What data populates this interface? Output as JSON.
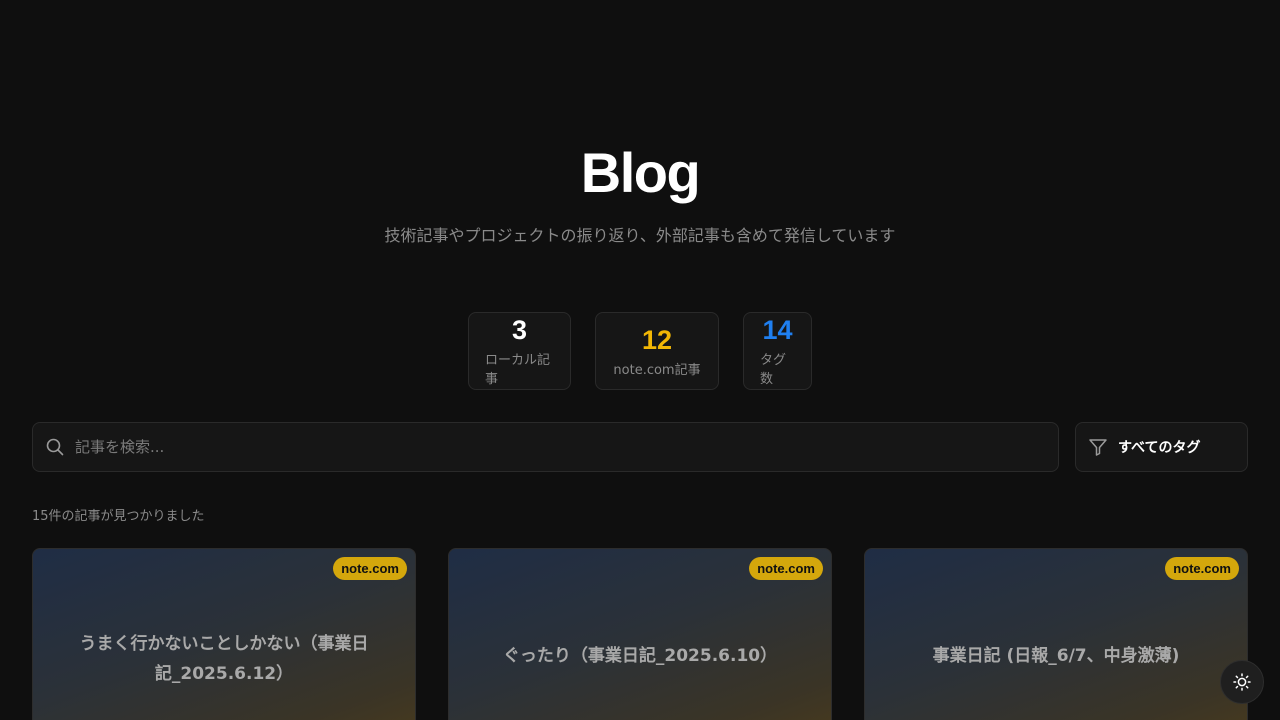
{
  "hero": {
    "title": "Blog",
    "subtitle": "技術記事やプロジェクトの振り返り、外部記事も含めて発信しています"
  },
  "stats": [
    {
      "value": "3",
      "label": "ローカル記事",
      "color": "#ffffff"
    },
    {
      "value": "12",
      "label": "note.com記事",
      "color": "#f2b705"
    },
    {
      "value": "14",
      "label": "タグ数",
      "color": "#1f7ff0"
    }
  ],
  "search": {
    "icon": "search-icon",
    "placeholder": "記事を検索..."
  },
  "filter": {
    "icon": "filter-icon",
    "label": "すべてのタグ"
  },
  "results": {
    "count_text": "15件の記事が見つかりました"
  },
  "articles": [
    {
      "badge": "note.com",
      "title": "うまく行かないことしかない（事業日記_2025.6.12）"
    },
    {
      "badge": "note.com",
      "title": "ぐったり（事業日記_2025.6.10）"
    },
    {
      "badge": "note.com",
      "title": "事業日記 (日報_6/7、中身激薄)"
    }
  ],
  "theme_toggle": {
    "icon": "sun-icon"
  },
  "colors": {
    "background": "#0f0f0f",
    "badge": "#d4a70c",
    "accent_yellow": "#f2b705",
    "accent_blue": "#1f7ff0"
  }
}
